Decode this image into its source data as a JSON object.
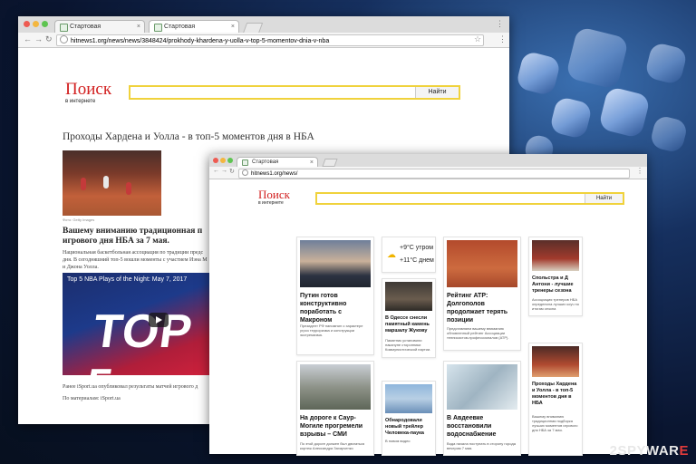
{
  "window1": {
    "tabs": [
      {
        "label": "Стартовая"
      },
      {
        "label": "Стартовая"
      }
    ],
    "url": "hitnews1.org/news/news/3848424/prokhody-khardena-y-uolla-v-top-5-momentov-dnia-v-nba",
    "logo": {
      "title": "Поиск",
      "sub": "в интернете"
    },
    "search": {
      "button": "Найти"
    },
    "article": {
      "title": "Проходы Хардена и Уолла - в топ-5 моментов дня в НБА",
      "photo_caption": "Фото: Getty Images",
      "subtitle_line1": "Вашему вниманию традиционная п",
      "subtitle_line2": "игрового дня НБА за 7 мая.",
      "paragraph_line1": "Национальная баскетбольная ассоциация по традиции предс",
      "paragraph_line2": "дня. В сегодняшний топ-5 вошли моменты с участием Иэна М",
      "paragraph_line3": "и Джона Уолла.",
      "video_title": "Top 5 NBA Plays of the Night: May 7, 2017",
      "video_big": "TOP 5",
      "footer1": "Ранее iSport.ua опубликовал результаты матчей игрового д",
      "footer2": "По материалам: iSport.ua"
    }
  },
  "window2": {
    "tab": "Стартовая",
    "url": "hitnews1.org/news/",
    "logo": {
      "title": "Поиск",
      "sub": "в интернете"
    },
    "search": {
      "button": "Найти"
    },
    "weather": {
      "temp1": "+9°C утром",
      "temp2": "+11°C днем"
    },
    "cards": [
      {
        "headline": "Путин готов конструктивно поработать с Макроном",
        "desc": "Президент РФ напомнил о характере угроз терроризма и конструкции экстремизма."
      },
      {
        "headline": "В Одессе снесли памятный камень маршалу Жукову",
        "desc": "Памятник установили накануне сторонники Коммунистической партии."
      },
      {
        "headline": "Рейтинг ATP: Долгополов продолжает терять позиции",
        "desc": "Представляем вашему вниманию обновленный рейтинг Ассоциации теннисистов-профессионалов (ATP)."
      },
      {
        "headline": "Спольстра и Д Антони - лучшие тренеры сезона",
        "desc": "Ассоциация тренеров НБА определила лучших коуч по итогам сезона"
      },
      {
        "headline": "На дороге к Саур-Могиле прогремели взрывы – СМИ",
        "desc": "По этой дороге должен был двигаться кортеж Александра Захарченко"
      },
      {
        "headline": "Обнародовали новый трейлер Человека-паука",
        "desc": "В новом видео"
      },
      {
        "headline": "В Авдеевке восстановили водоснабжение",
        "desc": "Вода начала поступать в сторону города вечером 7 мая."
      },
      {
        "headline": "Проходы Хардена и Уолла - в топ-5 моментов дня в НБА",
        "desc": "Вашему вниманию традиционная подборка лучших моментов игрового дня НБА за 7 мая."
      }
    ]
  },
  "watermark": {
    "part1": "2",
    "part2": "SPYWAR",
    "part3": "E"
  }
}
